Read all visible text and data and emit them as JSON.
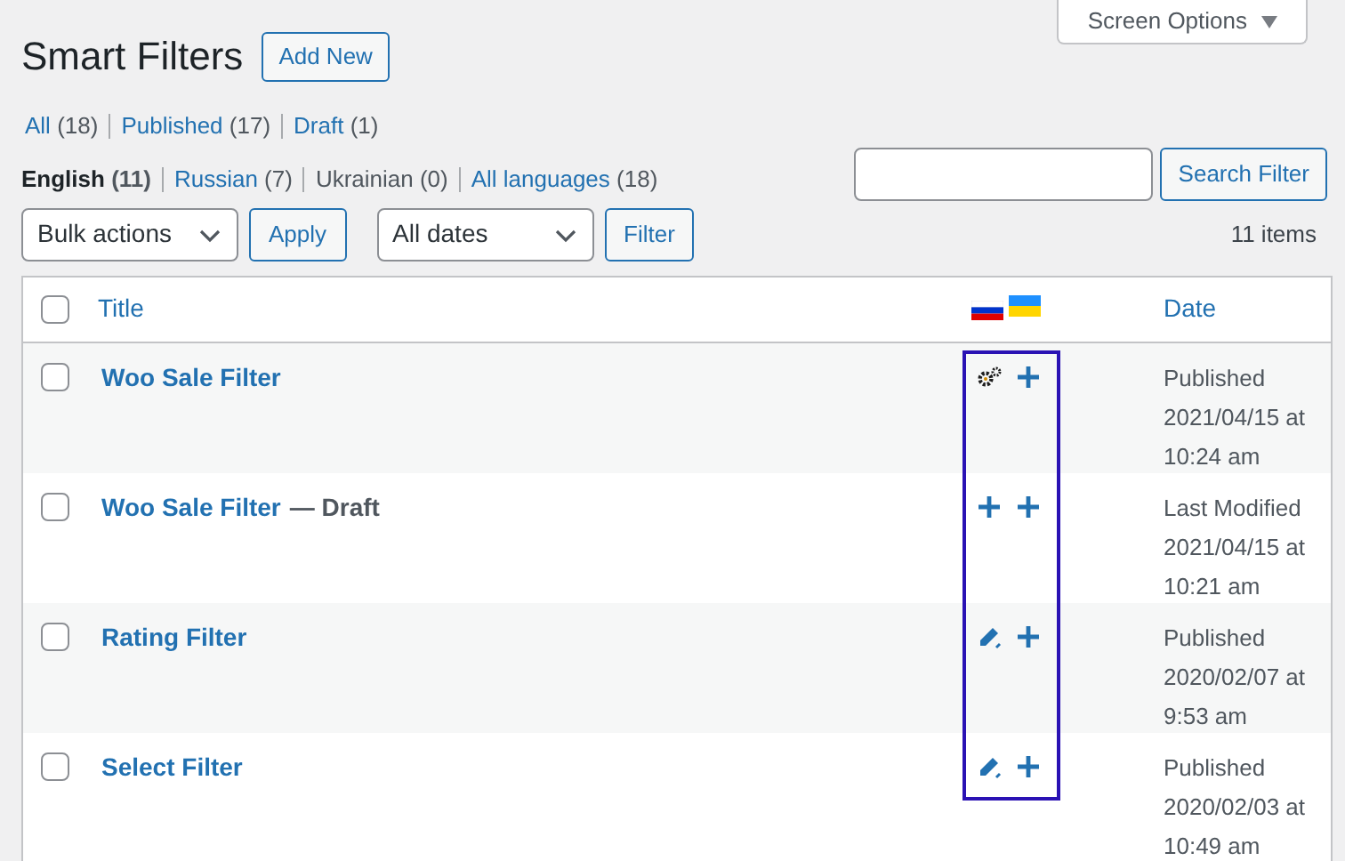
{
  "screen_options": {
    "label": "Screen Options",
    "expanded": false
  },
  "heading": {
    "title": "Smart Filters",
    "add_new": "Add New"
  },
  "status_views": [
    {
      "label": "All",
      "count": "(18)",
      "selected": false
    },
    {
      "label": "Published",
      "count": "(17)",
      "selected": false
    },
    {
      "label": "Draft",
      "count": "(1)",
      "selected": false
    }
  ],
  "language_views": [
    {
      "label": "English",
      "count": "(11)",
      "selected": true
    },
    {
      "label": "Russian",
      "count": "(7)",
      "selected": false
    },
    {
      "label": "Ukrainian",
      "count": "(0)",
      "selected": false,
      "disabled": true
    },
    {
      "label": "All languages",
      "count": "(18)",
      "selected": false
    }
  ],
  "search": {
    "button": "Search Filter"
  },
  "toolbar": {
    "bulk_actions": "Bulk actions",
    "apply": "Apply",
    "dates": "All dates",
    "filter": "Filter",
    "items": "11 items"
  },
  "table": {
    "columns": [
      {
        "kind": "checkbox",
        "checked": false
      },
      {
        "kind": "text",
        "label": "Title"
      },
      {
        "kind": "flags"
      },
      {
        "kind": "text",
        "label": "Date"
      }
    ],
    "rows": [
      {
        "checked": false,
        "title": "Woo Sale Filter",
        "translations": [
          {
            "kind": "gear"
          },
          {
            "kind": "plus"
          }
        ],
        "status": "Published",
        "date": "2021/04/15 at 10:24 am"
      },
      {
        "checked": false,
        "title": "Woo Sale Filter",
        "state": "— Draft",
        "translations": [
          {
            "kind": "plus"
          },
          {
            "kind": "plus"
          }
        ],
        "status": "Last Modified",
        "date": "2021/04/15 at 10:21 am"
      },
      {
        "checked": false,
        "title": "Rating Filter",
        "translations": [
          {
            "kind": "pencil"
          },
          {
            "kind": "plus"
          }
        ],
        "status": "Published",
        "date": "2020/02/07 at 9:53 am"
      },
      {
        "checked": false,
        "title": "Select Filter",
        "translations": [
          {
            "kind": "pencil"
          },
          {
            "kind": "plus"
          }
        ],
        "status": "Published",
        "date": "2020/02/03 at 10:49 am"
      }
    ]
  }
}
